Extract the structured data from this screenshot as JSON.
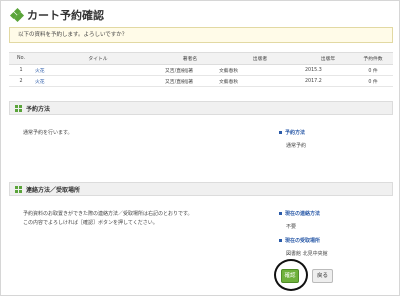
{
  "page": {
    "title": "カート予約確認"
  },
  "notice": "以下の資料を予約します。よろしいですか？",
  "table": {
    "headers": {
      "no": "No.",
      "title": "タイトル",
      "author": "著者名",
      "publisher": "出版者",
      "year": "出版年",
      "reserve_count": "予約件数"
    },
    "rows": [
      {
        "no": "1",
        "title": "火花",
        "author": "又吉/直樹∥著",
        "publisher": "文藝春秋",
        "year": "2015.3",
        "reserve_count": "0 件"
      },
      {
        "no": "2",
        "title": "火花",
        "author": "又吉/直樹∥著",
        "publisher": "文藝春秋",
        "year": "2017.2",
        "reserve_count": "0 件"
      }
    ]
  },
  "reservation_method": {
    "heading": "予約方法",
    "description": "通常予約を行います。",
    "label": "予約方法",
    "value": "通常予約"
  },
  "contact": {
    "heading": "連絡方法／受取場所",
    "description_line1": "予約資料のお取置きができた際の連絡方法／受取場所は右記のとおりです。",
    "description_line2": "この内容でよろしければ［確認］ボタンを押してください。",
    "contact_label": "現在の連絡方法",
    "contact_value": "不要",
    "pickup_label": "現在の受取場所",
    "pickup_value": "図書館 北見中央館"
  },
  "buttons": {
    "confirm": "確認",
    "back": "戻る"
  },
  "colors": {
    "accent_green": "#5aa43a",
    "link_blue": "#2a5aa8",
    "notice_bg": "#fffbe8"
  }
}
